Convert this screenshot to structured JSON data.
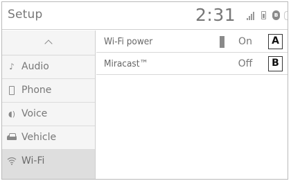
{
  "header": {
    "title": "Setup",
    "clock": "2:31",
    "icons": [
      "signal-icon",
      "battery-icon",
      "bluetooth-icon",
      "status-icon"
    ]
  },
  "sidebar": {
    "scroll_up_icon": "chevron-up-icon",
    "items": [
      {
        "label": "Audio",
        "icon": "music-note-icon"
      },
      {
        "label": "Phone",
        "icon": "phone-icon"
      },
      {
        "label": "Voice",
        "icon": "voice-icon"
      },
      {
        "label": "Vehicle",
        "icon": "car-icon"
      },
      {
        "label": "Wi-Fi",
        "icon": "wifi-icon",
        "selected": true
      }
    ]
  },
  "settings": {
    "rows": [
      {
        "label": "Wi-Fi power",
        "value": "On",
        "callout": "A"
      },
      {
        "label": "Miracast™",
        "value": "Off",
        "callout": "B"
      }
    ]
  },
  "colors": {
    "selected_background": "#dedede",
    "sidebar_background": "#f5f5f5",
    "toggle_indicator": "#8a8a8a"
  }
}
